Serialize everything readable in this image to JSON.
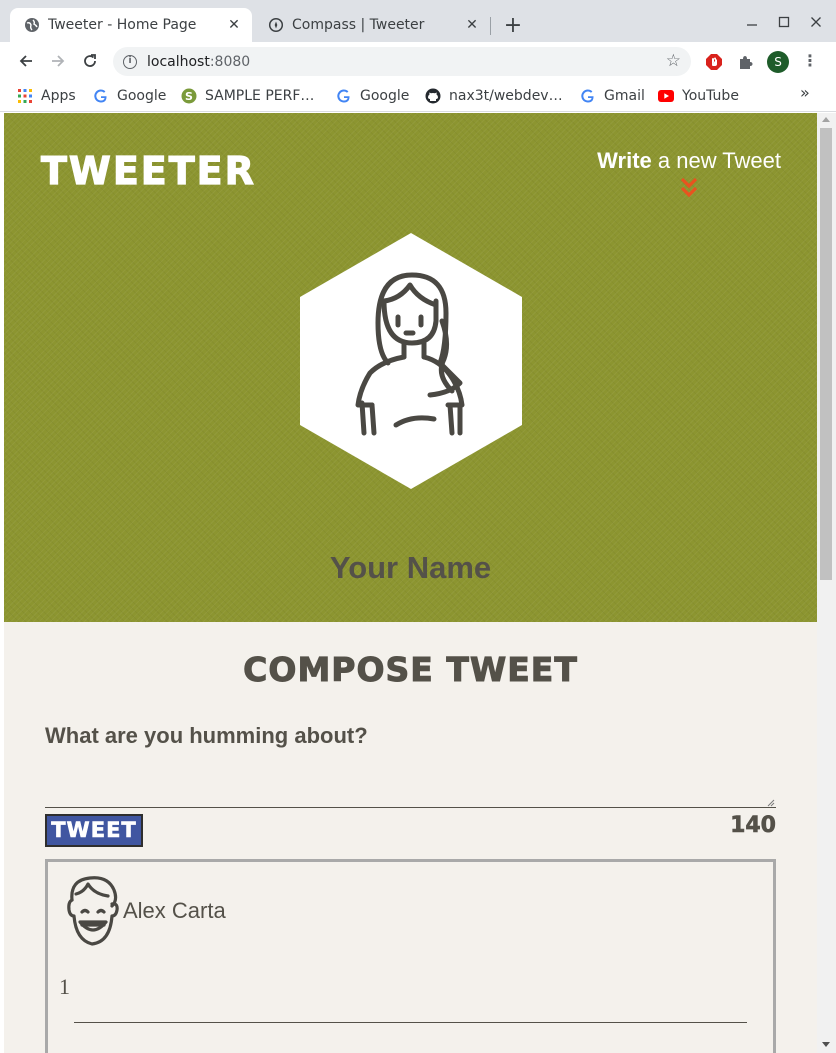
{
  "browser": {
    "tabs": [
      {
        "title": "Tweeter - Home Page",
        "active": true,
        "favicon": "globe-icon"
      },
      {
        "title": "Compass | Tweeter",
        "active": false,
        "favicon": "compass-icon"
      }
    ],
    "new_tab_label": "+",
    "url_host": "localhost",
    "url_port": ":8080",
    "profile_initial": "S",
    "bookmarks": [
      {
        "label": "Apps",
        "icon": "apps-grid-icon"
      },
      {
        "label": "Google",
        "icon": "google-icon"
      },
      {
        "label": "SAMPLE PERF…",
        "icon": "sample-icon"
      },
      {
        "label": "Google",
        "icon": "google-icon"
      },
      {
        "label": "nax3t/webdev…",
        "icon": "github-icon"
      },
      {
        "label": "Gmail",
        "icon": "google-icon"
      },
      {
        "label": "YouTube",
        "icon": "youtube-icon"
      }
    ],
    "bookmarks_overflow": "»"
  },
  "header": {
    "brand": "TWEETER",
    "write_strong": "Write",
    "write_rest": " a new Tweet",
    "profile_name": "Your Name"
  },
  "compose": {
    "title": "COMPOSE TWEET",
    "label": "What are you humming about?",
    "textarea_value": "",
    "submit_label": "TWEET",
    "counter": "140"
  },
  "tweets": [
    {
      "author": "Alex Carta",
      "body": "1"
    }
  ],
  "colors": {
    "header_bg": "#8c9530",
    "page_bg": "#f4f1ec",
    "text": "#545149",
    "accent_chevron": "#e8531f",
    "tweet_button": "#4056a1"
  }
}
